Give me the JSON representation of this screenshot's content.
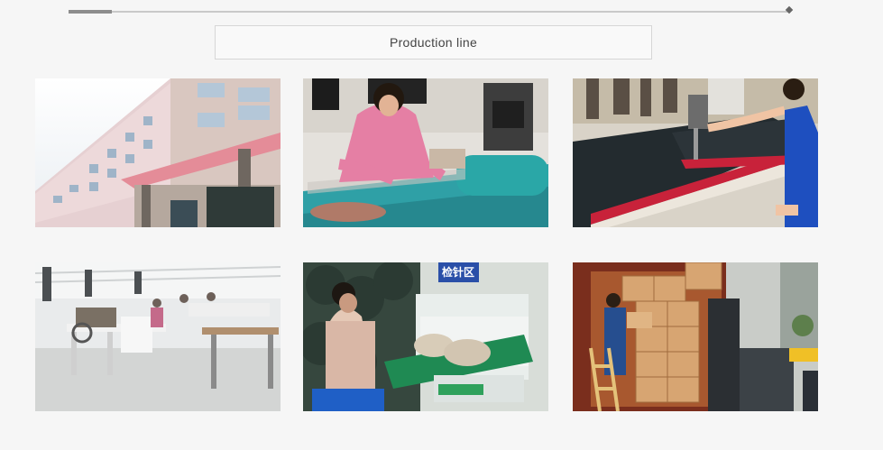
{
  "section": {
    "title": "Production line"
  },
  "gallery": {
    "photos": [
      {
        "subject": "factory-building"
      },
      {
        "subject": "worker-tracing-pattern-on-fabric"
      },
      {
        "subject": "worker-cutting-foam-layers"
      },
      {
        "subject": "sewing-workshop"
      },
      {
        "subject": "metal-detector-inspection",
        "sign": "检针区"
      },
      {
        "subject": "loading-cartons-with-forklift"
      }
    ]
  },
  "progress": {
    "value": 0.06
  },
  "colors": {
    "background": "#f6f6f6",
    "border": "#d6d6d6",
    "title_text": "#444444"
  }
}
